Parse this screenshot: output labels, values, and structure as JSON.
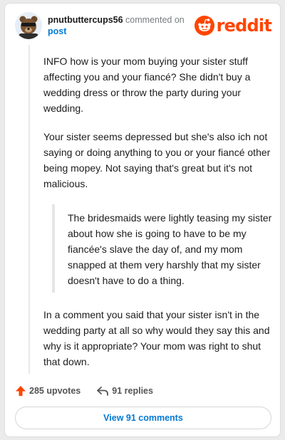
{
  "header": {
    "username": "pnutbuttercups56",
    "action_text": "commented on",
    "post_link": "post",
    "logo_text": "reddit"
  },
  "comment": {
    "paragraphs": [
      "INFO how is your mom buying your sister stuff affecting you and your fiancé? She didn't buy a wedding dress or throw the party during your wedding.",
      "Your sister seems depressed but she's also ich not saying or doing anything to you or your fiancé other being mopey. Not saying that's great but it's not malicious.",
      "In a comment you said that your sister isn't in the wedding party at all so why would they say this and why is it appropriate? Your mom was right to shut that down."
    ],
    "quote": "The bridesmaids were lightly teasing my sister about how she is going to have to be my fiancée's slave the day of, and my mom snapped at them very harshly that my sister doesn't have to do a thing."
  },
  "actions": {
    "upvotes": "285 upvotes",
    "replies": "91 replies",
    "view_comments": "View 91 comments"
  },
  "colors": {
    "brand": "#ff4500",
    "link": "#0079d3",
    "muted": "#787c7e"
  },
  "icons": {
    "avatar": "bear-avatar",
    "logo": "reddit-snoo-icon",
    "upvote": "upvote-arrow-icon",
    "reply": "reply-arrow-icon"
  }
}
